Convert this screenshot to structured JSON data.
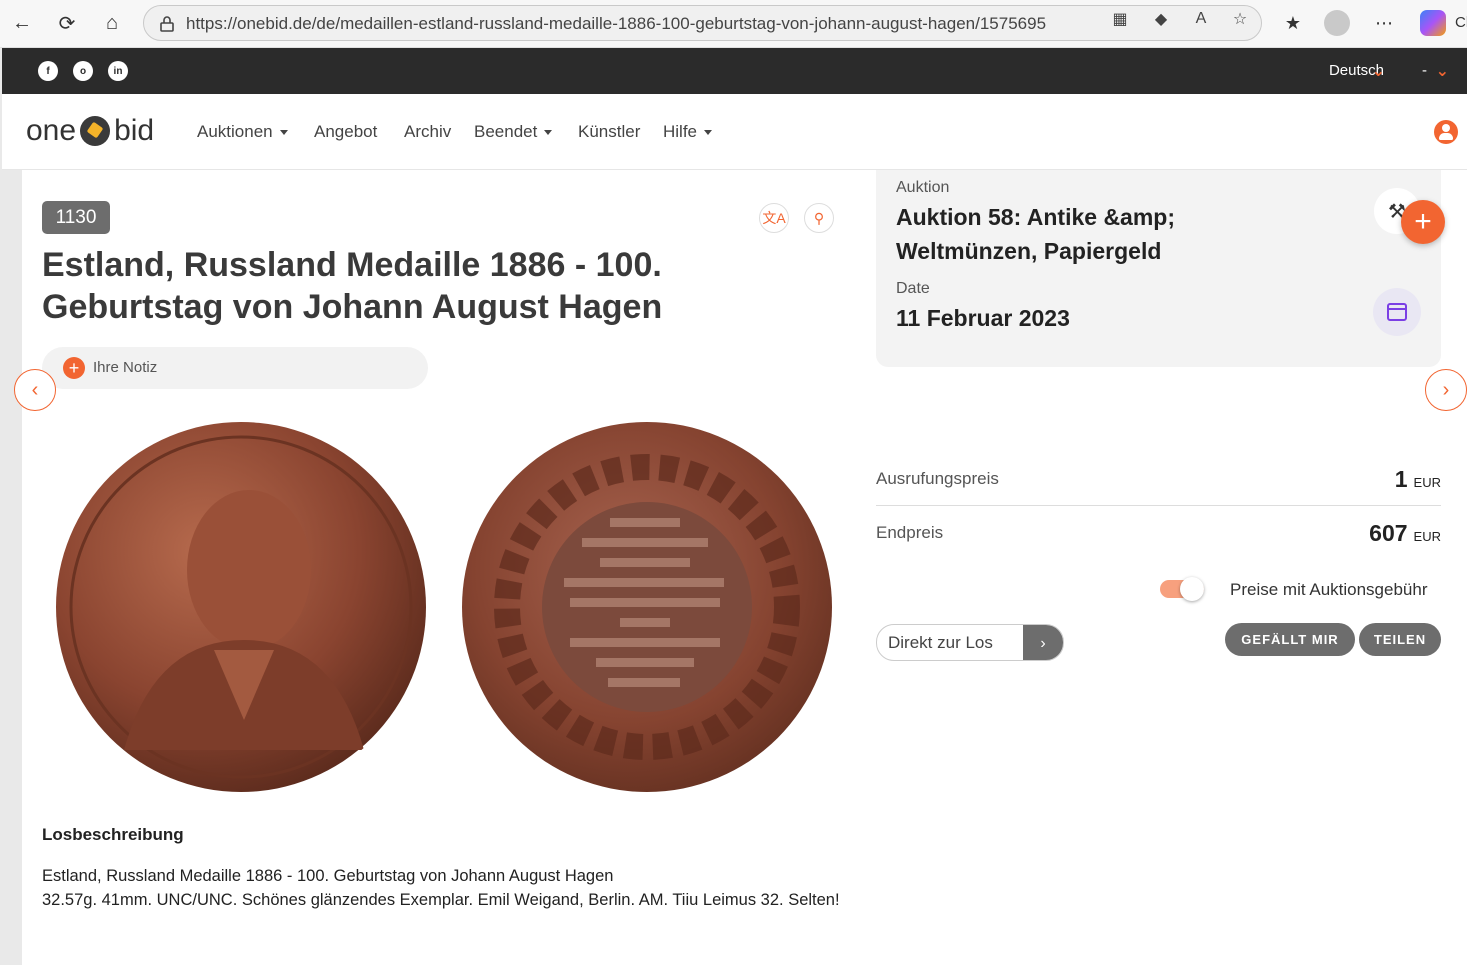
{
  "browser": {
    "url": "https://onebid.de/de/medaillen-estland-russland-medaille-1886-100-geburtstag-von-johann-august-hagen/1575695",
    "profile_label": "Cl"
  },
  "topbar": {
    "language": "Deutsch",
    "currency": "-"
  },
  "nav": {
    "logo_left": "one",
    "logo_right": "bid",
    "items": [
      "Auktionen",
      "Angebot",
      "Archiv",
      "Beendet",
      "Künstler",
      "Hilfe"
    ]
  },
  "lot": {
    "number": "1130",
    "title": "Estland, Russland Medaille 1886 - 100. Geburtstag von Johann August Hagen",
    "note_label": "Ihre Notiz",
    "description_heading": "Losbeschreibung",
    "description_line1": "Estland, Russland Medaille 1886 - 100. Geburtstag von Johann August Hagen",
    "description_line2": "32.57g. 41mm. UNC/UNC. Schönes glänzendes Exemplar. Emil Weigand, Berlin. AM. Tiiu Leimus 32. Selten!"
  },
  "auction": {
    "label": "Auktion",
    "name": "Auktion 58: Antike &amp; Weltmünzen, Papiergeld",
    "date_label": "Date",
    "date": "11 Februar 2023"
  },
  "prices": {
    "start_label": "Ausrufungspreis",
    "start_value": "1",
    "final_label": "Endpreis",
    "final_value": "607",
    "currency": "EUR",
    "toggle_label": "Preise mit Auktionsgebühr"
  },
  "actions": {
    "direct_placeholder": "Direkt zur Los",
    "like": "GEFÄLLT MIR",
    "share": "TEILEN"
  },
  "colors": {
    "accent": "#f26531",
    "dark": "#2b2b2b",
    "badge": "#6d6d6d",
    "calendar": "#7b3fe4"
  }
}
